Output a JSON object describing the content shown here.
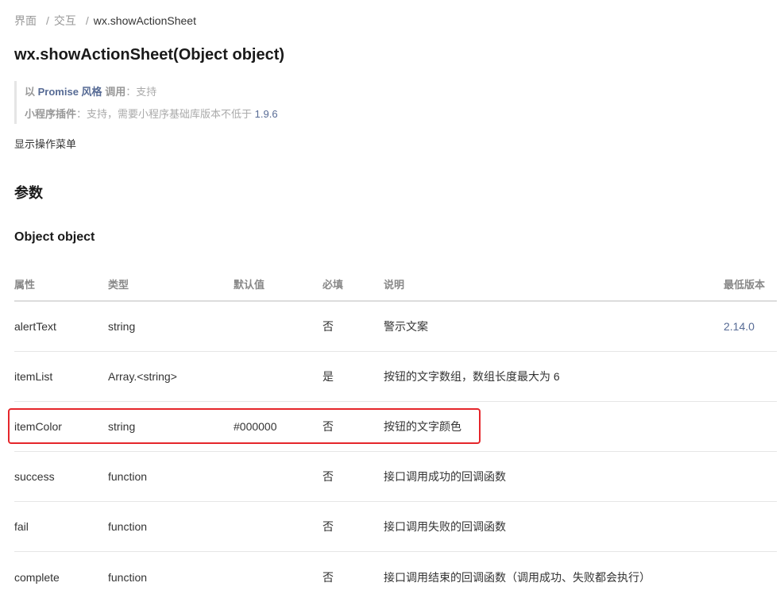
{
  "breadcrumb": {
    "items": [
      "界面",
      "交互"
    ],
    "separator": "/",
    "current": "wx.showActionSheet"
  },
  "page_title": "wx.showActionSheet(Object object)",
  "note": {
    "line1_prefix": "以",
    "line1_link": "Promise 风格",
    "line1_label": "调用",
    "line1_value": "：支持",
    "line2_label": "小程序插件",
    "line2_value": "：支持，需要小程序基础库版本不低于",
    "line2_version": "1.9.6"
  },
  "description": "显示操作菜单",
  "section_params": "参数",
  "section_object": "Object object",
  "table": {
    "headers": [
      "属性",
      "类型",
      "默认值",
      "必填",
      "说明",
      "最低版本"
    ],
    "rows": [
      {
        "name": "alertText",
        "type": "string",
        "default": "",
        "required": "否",
        "desc": "警示文案",
        "version": "2.14.0"
      },
      {
        "name": "itemList",
        "type": "Array.<string>",
        "default": "",
        "required": "是",
        "desc": "按钮的文字数组，数组长度最大为 6",
        "version": ""
      },
      {
        "name": "itemColor",
        "type": "string",
        "default": "#000000",
        "required": "否",
        "desc": "按钮的文字颜色",
        "version": ""
      },
      {
        "name": "success",
        "type": "function",
        "default": "",
        "required": "否",
        "desc": "接口调用成功的回调函数",
        "version": ""
      },
      {
        "name": "fail",
        "type": "function",
        "default": "",
        "required": "否",
        "desc": "接口调用失败的回调函数",
        "version": ""
      },
      {
        "name": "complete",
        "type": "function",
        "default": "",
        "required": "否",
        "desc": "接口调用结束的回调函数（调用成功、失败都会执行）",
        "version": ""
      }
    ]
  },
  "colors": {
    "link": "#576b95",
    "highlight_border": "#e5262b",
    "text": "#333333",
    "muted": "#999999"
  }
}
